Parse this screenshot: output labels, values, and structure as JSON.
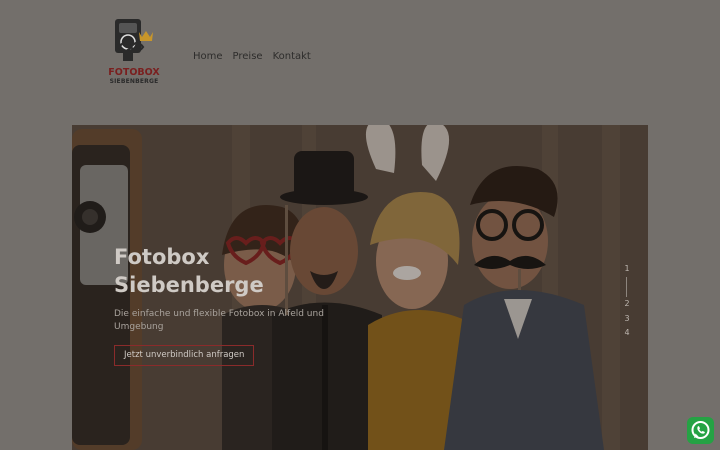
{
  "brand": {
    "line1": "FOTOBOX",
    "line2": "SIEBENBERGE",
    "colors": {
      "primary": "#7a1f1f",
      "gold": "#c8962a"
    }
  },
  "nav": {
    "items": [
      {
        "label": "Home"
      },
      {
        "label": "Preise"
      },
      {
        "label": "Kontakt"
      }
    ]
  },
  "hero": {
    "title": "Fotobox Siebenberge",
    "subtitle": "Die einfache und flexible Fotobox in Alfeld und Umgebung",
    "cta_label": "Jetzt unverbindlich anfragen",
    "slides": [
      "1",
      "2",
      "3",
      "4"
    ],
    "active_slide": 1
  },
  "whatsapp": {
    "icon": "whatsapp-icon",
    "color": "#25a244"
  }
}
